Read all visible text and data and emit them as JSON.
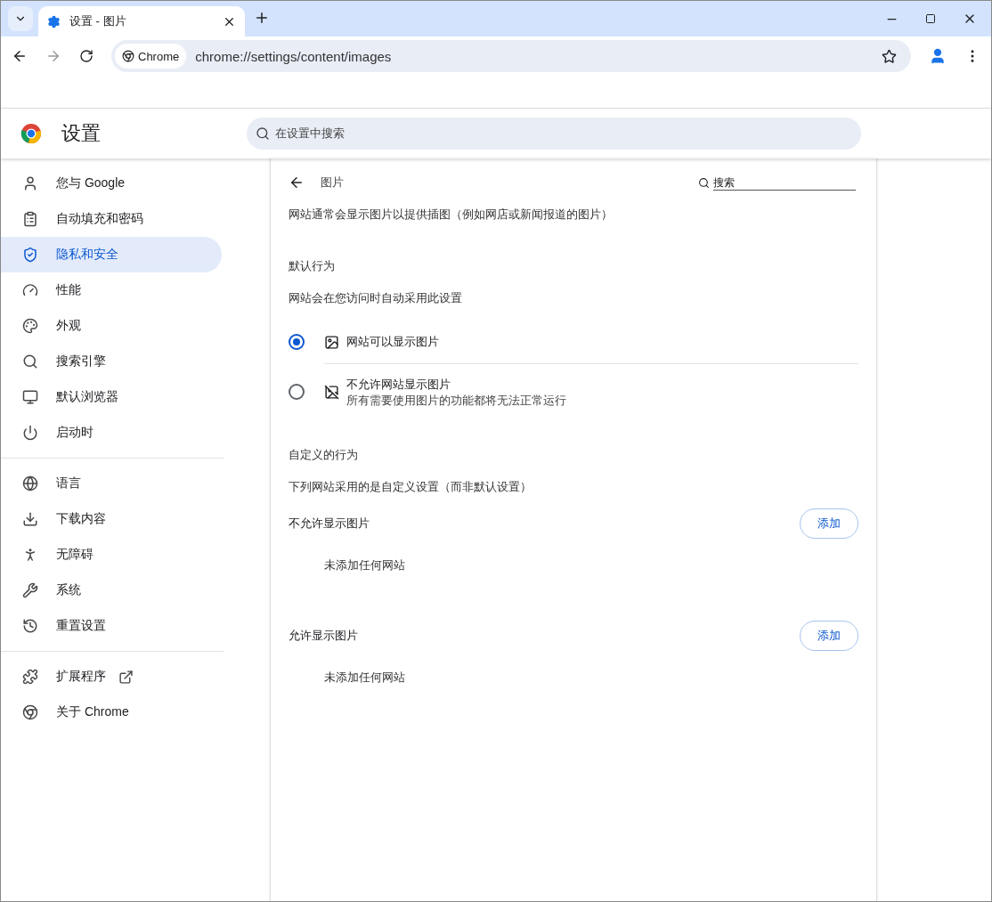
{
  "tab_strip": {
    "tabs": [
      {
        "title": "设置 - 图片",
        "selected": true
      }
    ]
  },
  "toolbar": {
    "chip": "Chrome",
    "url": "chrome://settings/content/images"
  },
  "header": {
    "title": "设置",
    "search": {
      "placeholder": "在设置中搜索"
    }
  },
  "sidebar": {
    "groups": [
      {
        "items": [
          {
            "label": "您与 Google",
            "selected": false
          },
          {
            "label": "自动填充和密码",
            "selected": false
          },
          {
            "label": "隐私和安全",
            "selected": true
          },
          {
            "label": "性能",
            "selected": false
          },
          {
            "label": "外观",
            "selected": false
          },
          {
            "label": "搜索引擎",
            "selected": false
          },
          {
            "label": "默认浏览器",
            "selected": false
          },
          {
            "label": "启动时",
            "selected": false
          }
        ]
      },
      {
        "items": [
          {
            "label": "语言",
            "selected": false
          },
          {
            "label": "下载内容",
            "selected": false
          },
          {
            "label": "无障碍",
            "selected": false
          },
          {
            "label": "系统",
            "selected": false
          },
          {
            "label": "重置设置",
            "selected": false
          }
        ]
      },
      {
        "items": [
          {
            "label": "扩展程序",
            "selected": false
          },
          {
            "label": "关于 Chrome",
            "selected": false
          }
        ]
      }
    ]
  },
  "page": {
    "title": "图片",
    "search": {
      "placeholder": "搜索"
    },
    "description": "网站通常会显示图片以提供插图（例如网店或新闻报道的图片）",
    "default_heading": "默认行为",
    "default_subheading": "网站会在您访问时自动采用此设置",
    "options": [
      {
        "label": "网站可以显示图片",
        "selected": true
      },
      {
        "label": "不允许网站显示图片",
        "description": "所有需要使用图片的功能都将无法正常运行",
        "selected": false
      }
    ],
    "custom_heading": "自定义的行为",
    "custom_subheading": "下列网站采用的是自定义设置（而非默认设置）",
    "lists": [
      {
        "title": "不允许显示图片",
        "button": "添加",
        "empty": "未添加任何网站"
      },
      {
        "title": "允许显示图片",
        "button": "添加",
        "empty": "未添加任何网站"
      }
    ]
  }
}
